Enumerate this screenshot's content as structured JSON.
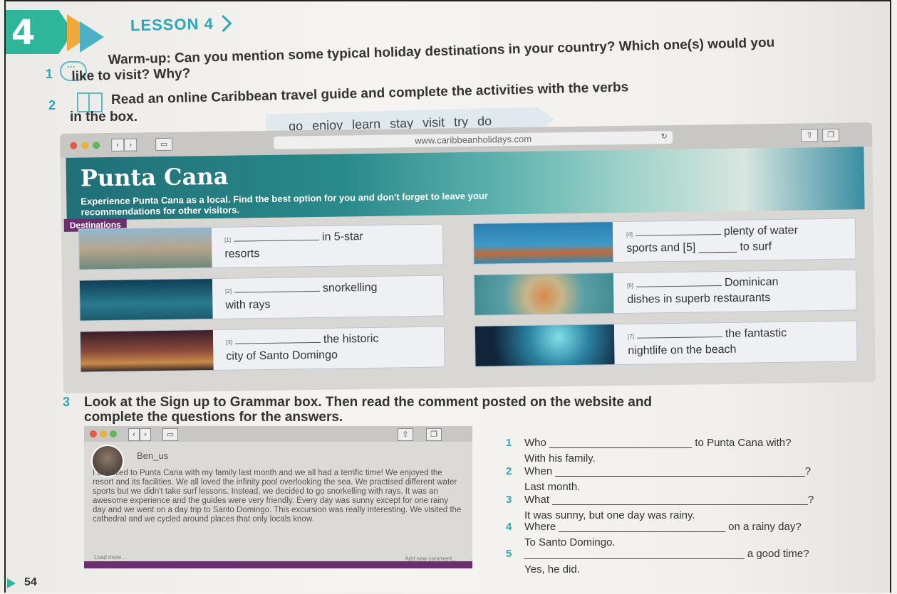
{
  "lesson": {
    "number": "4",
    "title": "LESSON 4"
  },
  "ex1": {
    "number": "1",
    "text": "Warm-up: Can you mention some typical holiday destinations in your country? Which one(s) would you like to visit? Why?"
  },
  "ex2": {
    "number": "2",
    "text_line1": "Read an online Caribbean travel guide and complete the activities with the verbs",
    "text_line2": "in the box."
  },
  "word_box": "go enjoy learn stay visit try do",
  "browser": {
    "url": "www.caribbeanholidays.com",
    "hero_title": "Punta Cana",
    "hero_subtitle": "Experience Punta Cana as a local. Find the best option for you and don't forget to leave your recommendations for other visitors.",
    "tab": "Destinations",
    "cards": [
      {
        "num": "[1]",
        "after": "in 5-star",
        "line2": "resorts"
      },
      {
        "num": "[4]",
        "after": "plenty of water",
        "line2": "sports and [5] ______ to surf"
      },
      {
        "num": "[2]",
        "after": "snorkelling",
        "line2": "with rays"
      },
      {
        "num": "[6]",
        "after": "Dominican",
        "line2": "dishes in superb restaurants"
      },
      {
        "num": "[3]",
        "after": "the historic",
        "line2": "city of Santo Domingo"
      },
      {
        "num": "[7]",
        "after": "the fantastic",
        "line2": "nightlife on the beach"
      }
    ]
  },
  "ex3": {
    "number": "3",
    "text_line1": "Look at the Sign up to Grammar box. Then read the comment posted on the website and",
    "text_line2": "complete the questions for the answers."
  },
  "comment": {
    "user": "Ben_us",
    "text": "I travelled to Punta Cana with my family last month and we all had a terrific time! We enjoyed the resort and its facilities. We all loved the infinity pool overlooking the sea. We practised different water sports but we didn't take surf lessons. Instead, we decided to go snorkelling with rays. It was an awesome experience and the guides were very friendly. Every day was sunny except for one rainy day and we went on a day trip to Santo Domingo. This excursion was really interesting. We visited the cathedral and we cycled around places that only locals know.",
    "load_more": "Load more...",
    "add_new": "Add new comment..."
  },
  "questions": [
    {
      "n": "1",
      "q": "Who ________________________ to Punta Cana with?",
      "a": "With his family."
    },
    {
      "n": "2",
      "q": "When __________________________________________?",
      "a": "Last month."
    },
    {
      "n": "3",
      "q": "What ___________________________________________?",
      "a": "It was sunny, but one day was rainy."
    },
    {
      "n": "4",
      "q": "Where ____________________________ on a rainy day?",
      "a": "To Santo Domingo."
    },
    {
      "n": "5",
      "q": "_____________________________________ a good time?",
      "a": "Yes, he did."
    }
  ],
  "page_number": "54",
  "colors": {
    "teal": "#2fb59a",
    "accent": "#2fa6b5",
    "orange": "#f2a93b",
    "purple": "#6b2f6f"
  }
}
